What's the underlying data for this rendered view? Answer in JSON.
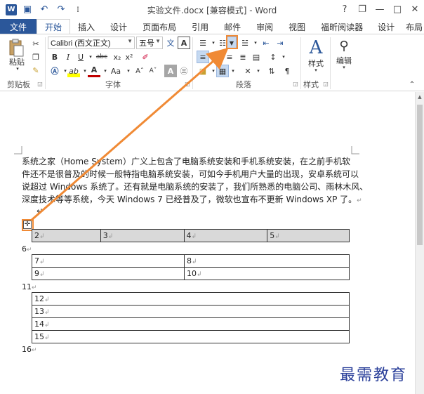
{
  "window": {
    "title": "实验文件.docx [兼容模式] - Word",
    "help": "?",
    "controls": {
      "ribbon_opts": "❐",
      "minimize": "—",
      "maximize": "□",
      "close": "✕"
    }
  },
  "qat": {
    "app_icon": "W",
    "save": "▣",
    "undo": "↶",
    "redo": "↷",
    "more": "⫾"
  },
  "tabs": [
    "文件",
    "开始",
    "插入",
    "设计",
    "页面布局",
    "引用",
    "邮件",
    "审阅",
    "视图",
    "福昕阅读器",
    "设计",
    "布局"
  ],
  "ribbon": {
    "paste_label": "粘贴",
    "clipboard_label": "剪贴板",
    "font_name": "Calibri (西文正文)",
    "font_size": "五号",
    "font_label": "字体",
    "paragraph_label": "段落",
    "styles_label": "样式",
    "styles_group_label": "样式",
    "edit_label": "编辑",
    "bold": "B",
    "italic": "I",
    "underline": "U",
    "strike": "abc",
    "sub": "x₂",
    "sup": "x²",
    "grow": "Aˆ",
    "shrink": "Aˇ",
    "case": "Aa",
    "highlight": "ab",
    "font_color": "A",
    "wen": "文",
    "box_a": "A",
    "char_shade": "A"
  },
  "document": {
    "paragraph_lines": [
      "系统之家（Home System）广义上包含了电脑系统安装和手机系统安装，在之前手机软",
      "件还不是很普及的时候一般特指电脑系统安装，可如今手机用户大量的出现，安卓系统可以",
      "说超过 Windows 系统了。还有就是电脑系统的安装了，我们所熟悉的电脑公司、雨林木风、",
      "深度技术等等系统，今天 Windows 7 已经普及了，微软也宣布不更新 Windows XP 了。"
    ],
    "para_mark": "↵",
    "table1": [
      "2",
      "3",
      "4",
      "5"
    ],
    "label_6": "6",
    "table2": [
      [
        "7",
        "8"
      ],
      [
        "9",
        "10"
      ]
    ],
    "label_11": "11",
    "table3": [
      "12",
      "13",
      "14",
      "15"
    ],
    "label_16": "16",
    "move_handle": "✛"
  },
  "watermark": "最需教育",
  "colors": {
    "brand": "#2b579a",
    "callout": "#f08a35"
  }
}
